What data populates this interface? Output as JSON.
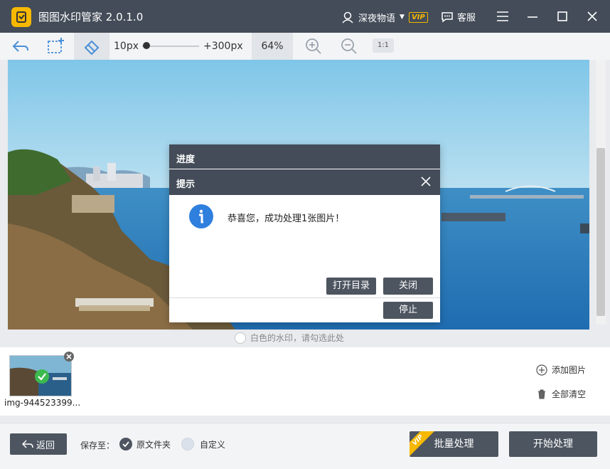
{
  "app": {
    "title": "图图水印管家  2.0.1.0"
  },
  "user": {
    "name": "深夜物语",
    "vip_badge": "VIP"
  },
  "service": {
    "label": "客服"
  },
  "toolbar": {
    "brush_min": "10px",
    "brush_max": "+300px",
    "brush_level": 0.08,
    "zoom": "64%",
    "actual_size": "1:1"
  },
  "watermark_option": {
    "label": "白色的水印，请勾选此处",
    "checked": false
  },
  "thumbnails": [
    {
      "name": "img-944523399...",
      "processed": true
    }
  ],
  "sidebar_actions": {
    "add_image": "添加图片",
    "clear_all": "全部清空"
  },
  "bottom": {
    "back_label": "返回",
    "save_to_label": "保存至：",
    "options": [
      {
        "label": "原文件夹",
        "checked": true
      },
      {
        "label": "自定义",
        "checked": false
      }
    ],
    "batch_label": "批量处理",
    "batch_badge": "VIP",
    "start_label": "开始处理"
  },
  "progress_dialog": {
    "title": "进度",
    "stop_label": "停止"
  },
  "tip_dialog": {
    "title": "提示",
    "message": "恭喜您，成功处理1张图片！",
    "open_dir_label": "打开目录",
    "close_label": "关闭"
  },
  "colors": {
    "titlebar": "#434c58",
    "button": "#4d5560",
    "vip": "#f6b800",
    "info": "#2f7fde",
    "check": "#3cba4f"
  }
}
